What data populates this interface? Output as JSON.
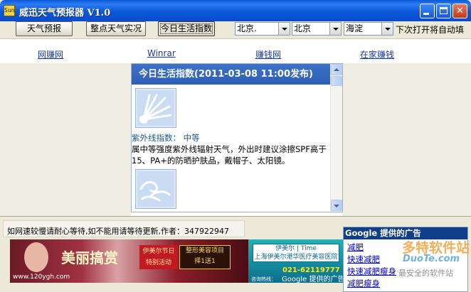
{
  "window": {
    "app_icon": "Sun",
    "title": "威迅天气预报器 V1.0"
  },
  "toolbar": {
    "forecast_button": "天气预报",
    "hourly_button": "整点天气实况",
    "lifeindex_button": "今日生活指数",
    "province_select": "北京.",
    "city_select": "北京",
    "district_select": "海淀",
    "autofill_text": "下次打开将自动填"
  },
  "links": [
    "网赚网",
    "Winrar",
    "赚钱网",
    "在家赚钱"
  ],
  "panel": {
    "title": "今日生活指数(2011-03-08 11:00发布)",
    "uv_label": "紫外线指数：  中等",
    "uv_desc": "属中等强度紫外线辐射天气，外出时建议涂擦SPF高于15、PA+的防晒护肤品，戴帽子、太阳镜。",
    "icons": [
      "sun-rays-icon",
      "wind-icon"
    ]
  },
  "status": {
    "notice": "如网速较慢请耐心等待,如不能用请等待更新,作者：347922947"
  },
  "banner": {
    "slogan": "美丽搞赏",
    "badge1": "伊美尔节日\n特别活动",
    "badge2": "整形美容项目\n择1送1",
    "url": "www.120ygh.com",
    "right_logo": "伊美尔 | Time\n上海伊美尔港华医疗美容医院",
    "phone": "021-62119777",
    "hotline": "咨询热线："
  },
  "google_credit": "Google 提供的广告",
  "google_ads": {
    "header": "Google 提供的广告",
    "links": [
      "减肥",
      "快速减肥",
      "快速减肥瘦身",
      "减肥瘦身"
    ]
  },
  "watermark": {
    "line1": "多特软件站",
    "line2": "DuoTe.com",
    "line3": "最安全的软件站"
  },
  "colors": {
    "title_blue": "#0a5ad9",
    "panel_header": "#3c72c7",
    "link_blue": "#1b3c98",
    "ad_header": "#0e3f88"
  }
}
